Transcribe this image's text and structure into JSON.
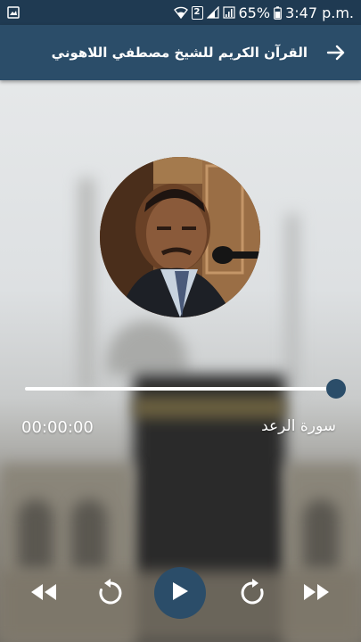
{
  "status_bar": {
    "battery_percent": "65%",
    "time": "3:47 p.m.",
    "sim_label": "2"
  },
  "app_bar": {
    "title": "القرآن الكريم للشيخ مصطفي اللاهوني"
  },
  "player": {
    "elapsed": "00:00:00",
    "track_name": "سورة الرعد",
    "progress_fraction": 1.0
  },
  "colors": {
    "status_bar": "#1f3a52",
    "app_bar": "#2b4d69",
    "accent": "#2b4d69"
  },
  "icons": {
    "back": "arrow-right-icon",
    "rewind": "rewind-icon",
    "replay": "replay-icon",
    "play": "play-icon",
    "forward_step": "forward-icon",
    "fast_forward": "fast-forward-icon"
  }
}
